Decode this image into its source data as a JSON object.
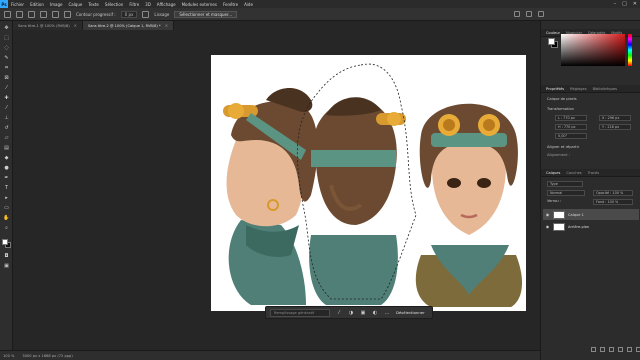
{
  "menubar": {
    "logo": "Ps",
    "items": [
      "Fichier",
      "Edition",
      "Image",
      "Calque",
      "Texte",
      "Sélection",
      "Filtre",
      "3D",
      "Affichage",
      "Modules externes",
      "Fenêtre",
      "Aide"
    ]
  },
  "options": {
    "contour_label": "Contour progressif :",
    "contour_value": "0 px",
    "lissage": "Lissage",
    "select_mask": "Sélectionner et masquer..."
  },
  "tabs": [
    {
      "label": "Sans titre-1 @ 100% (RVB/8)"
    },
    {
      "label": "Sans titre-2 @ 100% (Calque 1, RVB/8) *"
    }
  ],
  "context_bar": {
    "prompt_placeholder": "Remplissage génératif",
    "deselect": "Désélectionner"
  },
  "status": {
    "zoom": "100 %",
    "doc": "3000 px x 1688 px (72 ppp)"
  },
  "color_panel": {
    "tabs": [
      "Couleur",
      "Nuancier",
      "Dégradés",
      "Motifs"
    ],
    "colors": {
      "foreground": "#ffffff",
      "background": "#000000",
      "accent": "#31a8ff"
    }
  },
  "properties": {
    "tabs": [
      "Propriétés",
      "Réglages",
      "Bibliothèques"
    ],
    "layer_type": "Calque de pixels",
    "transform_title": "Transformation",
    "w": "L : 770 px",
    "h": "H : 770 px",
    "x": "X : 296 px",
    "y": "Y : 218 px",
    "angle": "0,00°",
    "align_title": "Aligner et répartir",
    "align_sub": "Alignement :"
  },
  "layers": {
    "tabs": [
      "Calques",
      "Couches",
      "Tracés"
    ],
    "kind": "Type",
    "blend_mode": "Normal",
    "opacity": "Opacité : 100 %",
    "lock_label": "Verrou :",
    "fill": "Fond : 100 %",
    "items": [
      {
        "name": "Calque 1"
      },
      {
        "name": "Arrière-plan"
      }
    ]
  }
}
